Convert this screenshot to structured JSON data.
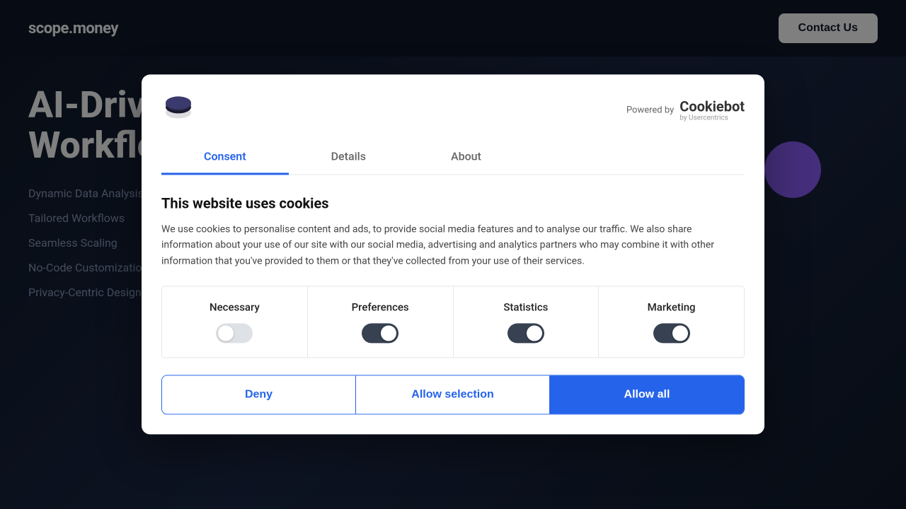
{
  "header": {
    "logo": "scope.money",
    "contact_btn": "Contact Us"
  },
  "hero": {
    "title": "AI-Driven\nWorkflows",
    "features": [
      "Dynamic Data Analysis",
      "Tailored Workflows",
      "Seamless Scaling",
      "No-Code Customization",
      "Privacy-Centric Design"
    ]
  },
  "cookie_modal": {
    "powered_by": "Powered by",
    "cookiebot_name": "Cookiebot",
    "cookiebot_sub": "by Usercentrics",
    "tabs": [
      "Consent",
      "Details",
      "About"
    ],
    "active_tab": "Consent",
    "title": "This website uses cookies",
    "description": "We use cookies to personalise content and ads, to provide social media features and to analyse our traffic. We also share information about your use of our site with our social media, advertising and analytics partners who may combine it with other information that you've provided to them or that they've collected from your use of their services.",
    "toggles": [
      {
        "label": "Necessary",
        "state": "off",
        "disabled": true
      },
      {
        "label": "Preferences",
        "state": "on-dark"
      },
      {
        "label": "Statistics",
        "state": "on-dark"
      },
      {
        "label": "Marketing",
        "state": "on-dark"
      }
    ],
    "buttons": {
      "deny": "Deny",
      "allow_selection": "Allow selection",
      "allow_all": "Allow all"
    }
  }
}
